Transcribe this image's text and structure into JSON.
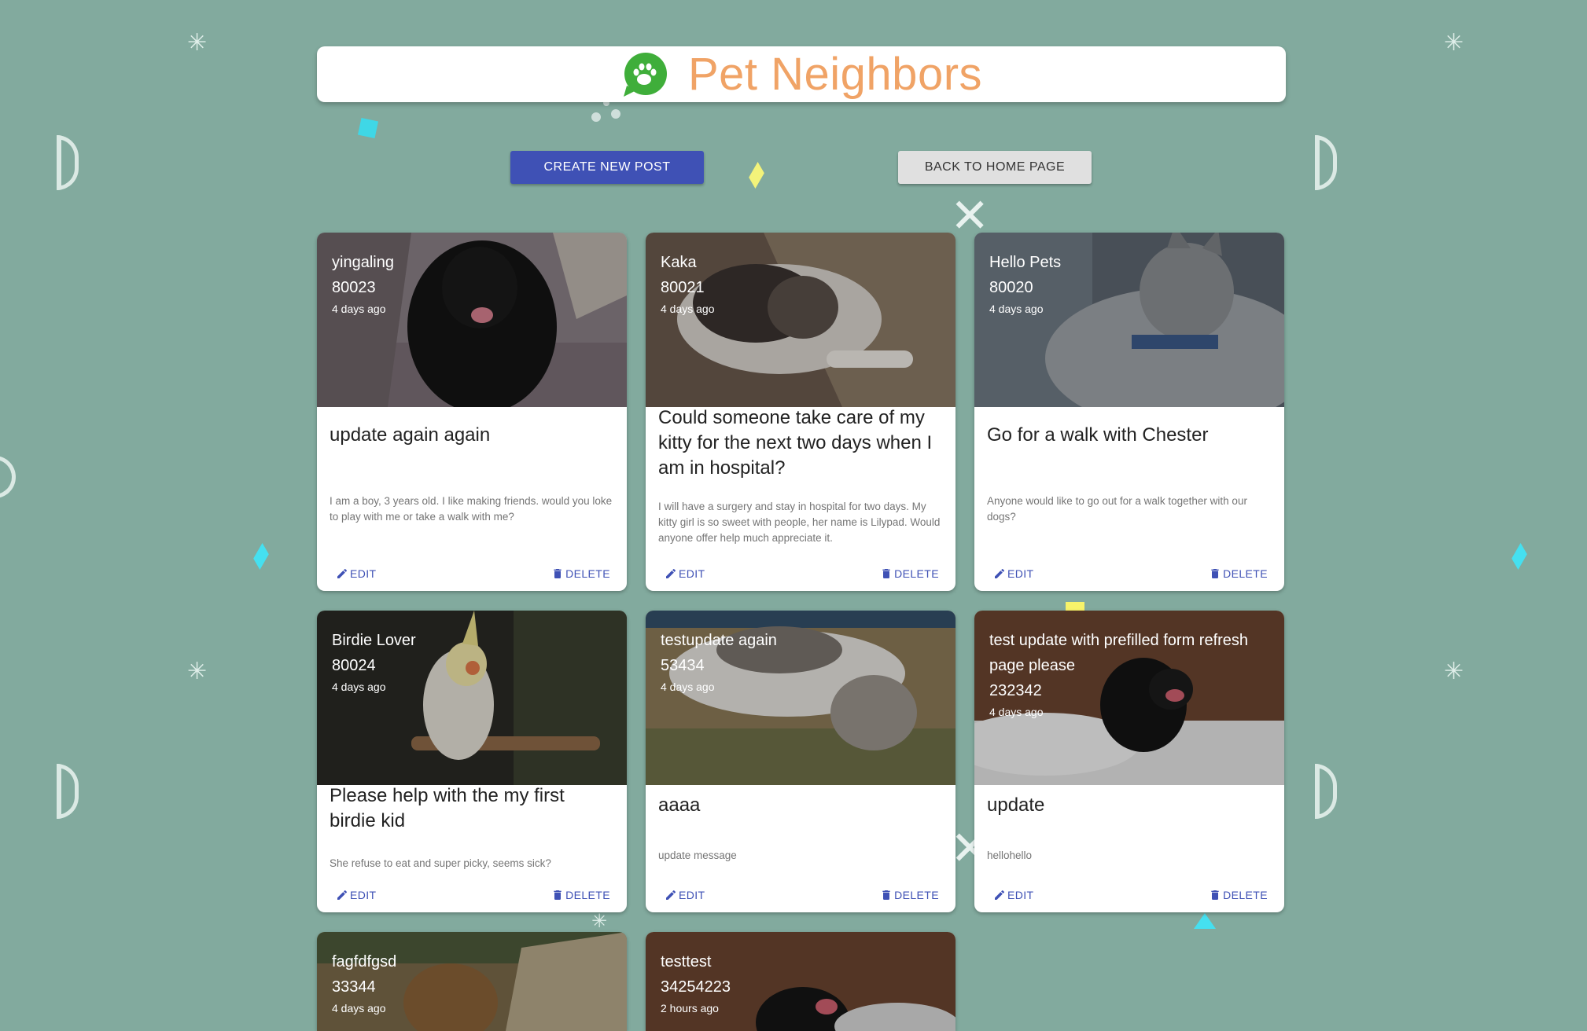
{
  "header": {
    "title": "Pet Neighbors"
  },
  "actions": {
    "create_label": "CREATE NEW POST",
    "home_label": "BACK TO HOME PAGE"
  },
  "card_actions": {
    "edit": "EDIT",
    "delete": "DELETE"
  },
  "posts": [
    {
      "name": "yingaling",
      "zip": "80023",
      "time": "4 days ago",
      "title": "update again again",
      "body": "I am a boy, 3 years old. I like making friends. would you loke to play with me or take a walk with me?",
      "image": "black-dog"
    },
    {
      "name": "Kaka",
      "zip": "80021",
      "time": "4 days ago",
      "title": "Could someone take care of my kitty for the next two days when I am in hospital?",
      "body": "I will have a surgery and stay in hospital for two days. My kitty girl is so sweet with people, her name is Lilypad. Would anyone offer help much appreciate it.",
      "image": "sleeping-cat"
    },
    {
      "name": "Hello Pets",
      "zip": "80020",
      "time": "4 days ago",
      "title": "Go for a walk with Chester",
      "body": "Anyone would like to go out for a walk together with our dogs?",
      "image": "gray-cat"
    },
    {
      "name": "Birdie Lover",
      "zip": "80024",
      "time": "4 days ago",
      "title": "Please help with the my first birdie kid",
      "body": "She refuse to eat and super picky, seems sick?",
      "image": "cockatiel"
    },
    {
      "name": "testupdate again",
      "zip": "53434",
      "time": "4 days ago",
      "title": "aaaa",
      "body": "update message",
      "image": "rug-cat"
    },
    {
      "name": "test update with prefilled form refresh page please",
      "zip": "232342",
      "time": "4 days ago",
      "title": "update",
      "body": "hellohello",
      "image": "snow-dog"
    },
    {
      "name": "fagfdfgsd",
      "zip": "33344",
      "time": "4 days ago",
      "title": "",
      "body": "",
      "image": "marmot"
    },
    {
      "name": "testtest",
      "zip": "34254223",
      "time": "2 hours ago",
      "title": "",
      "body": "",
      "image": "snow-dog"
    }
  ]
}
